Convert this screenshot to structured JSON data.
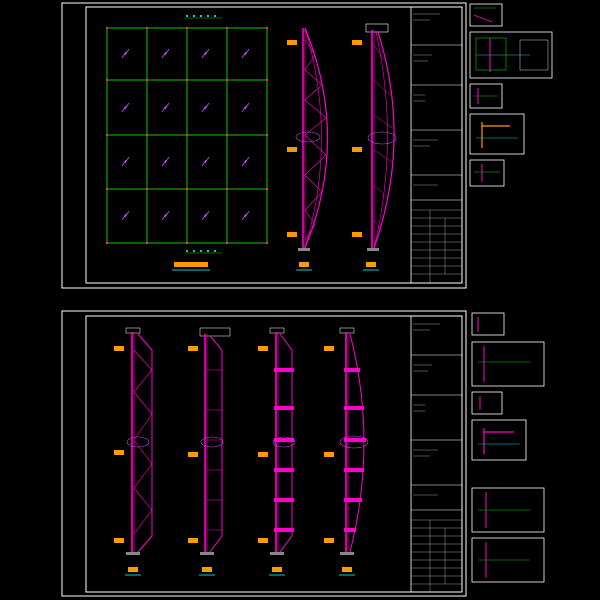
{
  "canvas": {
    "background": "#000000"
  },
  "colors": {
    "frame": "#ffffff",
    "grid": "#00cc00",
    "glass": "#cc44ff",
    "truss": "#ff00cc",
    "truss_dark": "#cc0099",
    "label": "#ff9900",
    "cyan": "#00cccc",
    "yellow": "#ffff00",
    "green_text": "#33ff33"
  },
  "sheets": [
    {
      "id": "sheet-1",
      "panel_grid": {
        "columns": 4,
        "rows": 4
      },
      "elevations": [
        "truss-arched-1",
        "truss-arched-2"
      ]
    },
    {
      "id": "sheet-2",
      "elevations": [
        "truss-straight",
        "truss-slim",
        "truss-ring",
        "truss-bulge"
      ]
    }
  ],
  "detail_thumbnails": {
    "sheet_1_count": 5,
    "sheet_2_count": 6
  }
}
